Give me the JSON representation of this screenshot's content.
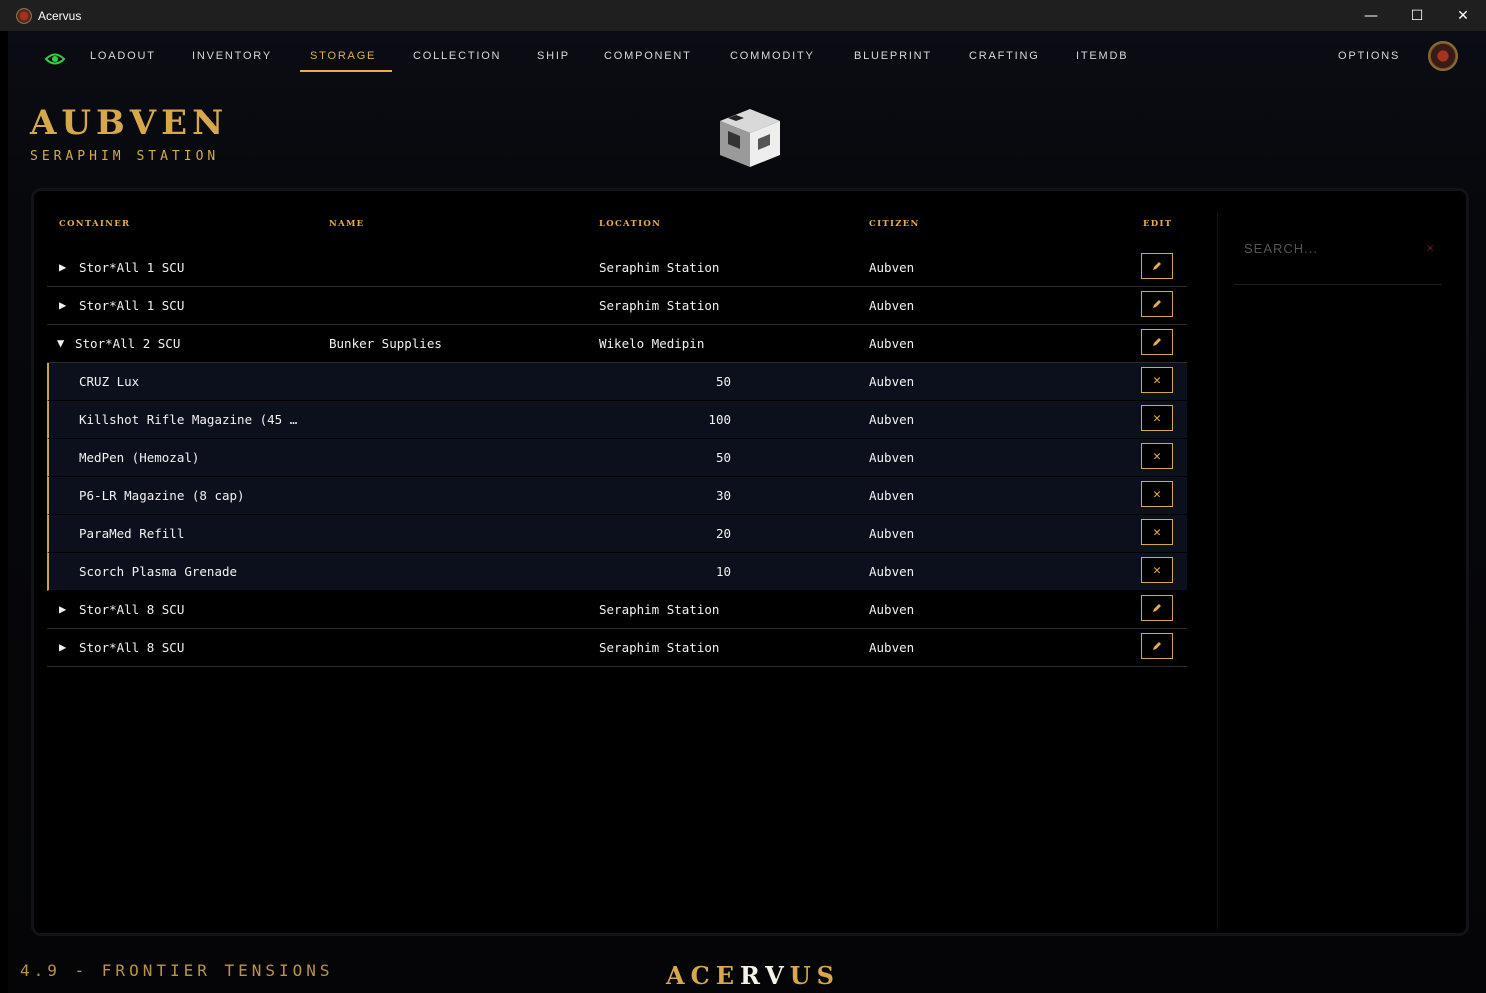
{
  "window": {
    "title": "Acervus",
    "minimize": "—",
    "maximize": "☐",
    "close": "✕"
  },
  "nav": {
    "items": [
      "LOADOUT",
      "INVENTORY",
      "STORAGE",
      "COLLECTION",
      "SHIP",
      "COMPONENT",
      "COMMODITY",
      "BLUEPRINT",
      "CRAFTING",
      "ITEMDB"
    ],
    "active": "STORAGE",
    "options": "OPTIONS"
  },
  "header": {
    "name": "AUBVEN",
    "station": "SERAPHIM STATION"
  },
  "table": {
    "columns": [
      "CONTAINER",
      "NAME",
      "LOCATION",
      "CITIZEN",
      "EDIT"
    ],
    "rows": [
      {
        "kind": "container",
        "expanded": false,
        "container": "Stor*All 1 SCU",
        "name": "",
        "location": "Seraphim Station",
        "citizen": "Aubven"
      },
      {
        "kind": "container",
        "expanded": false,
        "container": "Stor*All 1 SCU",
        "name": "",
        "location": "Seraphim Station",
        "citizen": "Aubven"
      },
      {
        "kind": "container",
        "expanded": true,
        "container": "Stor*All 2 SCU",
        "name": "Bunker Supplies",
        "location": "Wikelo Medipin",
        "citizen": "Aubven"
      },
      {
        "kind": "item",
        "item": "CRUZ Lux",
        "qty": "50",
        "citizen": "Aubven"
      },
      {
        "kind": "item",
        "item": "Killshot Rifle Magazine (45 …",
        "qty": "100",
        "citizen": "Aubven"
      },
      {
        "kind": "item",
        "item": "MedPen (Hemozal)",
        "qty": "50",
        "citizen": "Aubven"
      },
      {
        "kind": "item",
        "item": "P6-LR Magazine (8 cap)",
        "qty": "30",
        "citizen": "Aubven"
      },
      {
        "kind": "item",
        "item": "ParaMed Refill",
        "qty": "20",
        "citizen": "Aubven"
      },
      {
        "kind": "item",
        "item": "Scorch Plasma Grenade",
        "qty": "10",
        "citizen": "Aubven"
      },
      {
        "kind": "container",
        "expanded": false,
        "container": "Stor*All 8 SCU",
        "name": "",
        "location": "Seraphim Station",
        "citizen": "Aubven"
      },
      {
        "kind": "container",
        "expanded": false,
        "container": "Stor*All 8 SCU",
        "name": "",
        "location": "Seraphim Station",
        "citizen": "Aubven"
      }
    ]
  },
  "search": {
    "placeholder": "SEARCH...",
    "clear": "×"
  },
  "footer": {
    "version": "4.9 - FRONTIER TENSIONS",
    "brand_left": "ACE",
    "brand_mid": "RV",
    "brand_right": "US"
  },
  "icons": {
    "expanded": "▼",
    "collapsed": "▶",
    "edit": "pencil-icon",
    "delete": "close-icon"
  },
  "colors": {
    "accent": "#e3b04b",
    "eye": "#2fd23a",
    "child_row_bg": "#0b101c"
  }
}
